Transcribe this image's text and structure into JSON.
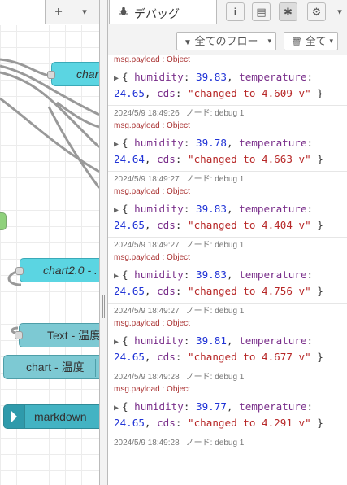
{
  "workspace": {
    "add_tab_symbol": "+",
    "menu_symbol": "▾",
    "nodes": [
      {
        "label": "char"
      },
      {
        "label": "chart2.0 - ."
      },
      {
        "label": "Text - 温度"
      },
      {
        "label": "chart - 温度"
      },
      {
        "label": "markdown"
      }
    ]
  },
  "sidebar": {
    "tab": {
      "label": "デバッグ",
      "icon": "bug-icon"
    },
    "tab_buttons": [
      {
        "icon": "info-icon",
        "symbol": "i"
      },
      {
        "icon": "book-icon",
        "symbol": "▤"
      },
      {
        "icon": "bug-icon",
        "symbol": "✱"
      },
      {
        "icon": "gear-icon",
        "symbol": "⚙"
      }
    ],
    "dropdown_symbol": "▾",
    "toolbar": {
      "filter_label": "全てのフロー",
      "clear_label": "全て"
    }
  },
  "messages": [
    {
      "meta": "",
      "node": "",
      "topic": "msg.payload : Object",
      "humidity": "39.83",
      "temperature": "24.65",
      "cds": "\"changed to 4.609 v\""
    },
    {
      "meta": "2024/5/9 18:49:26",
      "node": "ノード: debug 1",
      "topic": "msg.payload : Object",
      "humidity": "39.78",
      "temperature": "24.64",
      "cds": "\"changed to 4.663 v\""
    },
    {
      "meta": "2024/5/9 18:49:27",
      "node": "ノード: debug 1",
      "topic": "msg.payload : Object",
      "humidity": "39.83",
      "temperature": "24.65",
      "cds": "\"changed to 4.404 v\""
    },
    {
      "meta": "2024/5/9 18:49:27",
      "node": "ノード: debug 1",
      "topic": "msg.payload : Object",
      "humidity": "39.83",
      "temperature": "24.65",
      "cds": "\"changed to 4.756 v\""
    },
    {
      "meta": "2024/5/9 18:49:27",
      "node": "ノード: debug 1",
      "topic": "msg.payload : Object",
      "humidity": "39.81",
      "temperature": "24.65",
      "cds": "\"changed to 4.677 v\""
    },
    {
      "meta": "2024/5/9 18:49:28",
      "node": "ノード: debug 1",
      "topic": "msg.payload : Object",
      "humidity": "39.77",
      "temperature": "24.65",
      "cds": "\"changed to 4.291 v\""
    },
    {
      "meta": "2024/5/9 18:49:28",
      "node": "ノード: debug 1",
      "topic": "",
      "humidity": "",
      "temperature": "",
      "cds": ""
    }
  ],
  "payload_keys": {
    "humidity": "humidity",
    "temperature": "temperature",
    "cds": "cds"
  },
  "expand_symbol": "▶"
}
